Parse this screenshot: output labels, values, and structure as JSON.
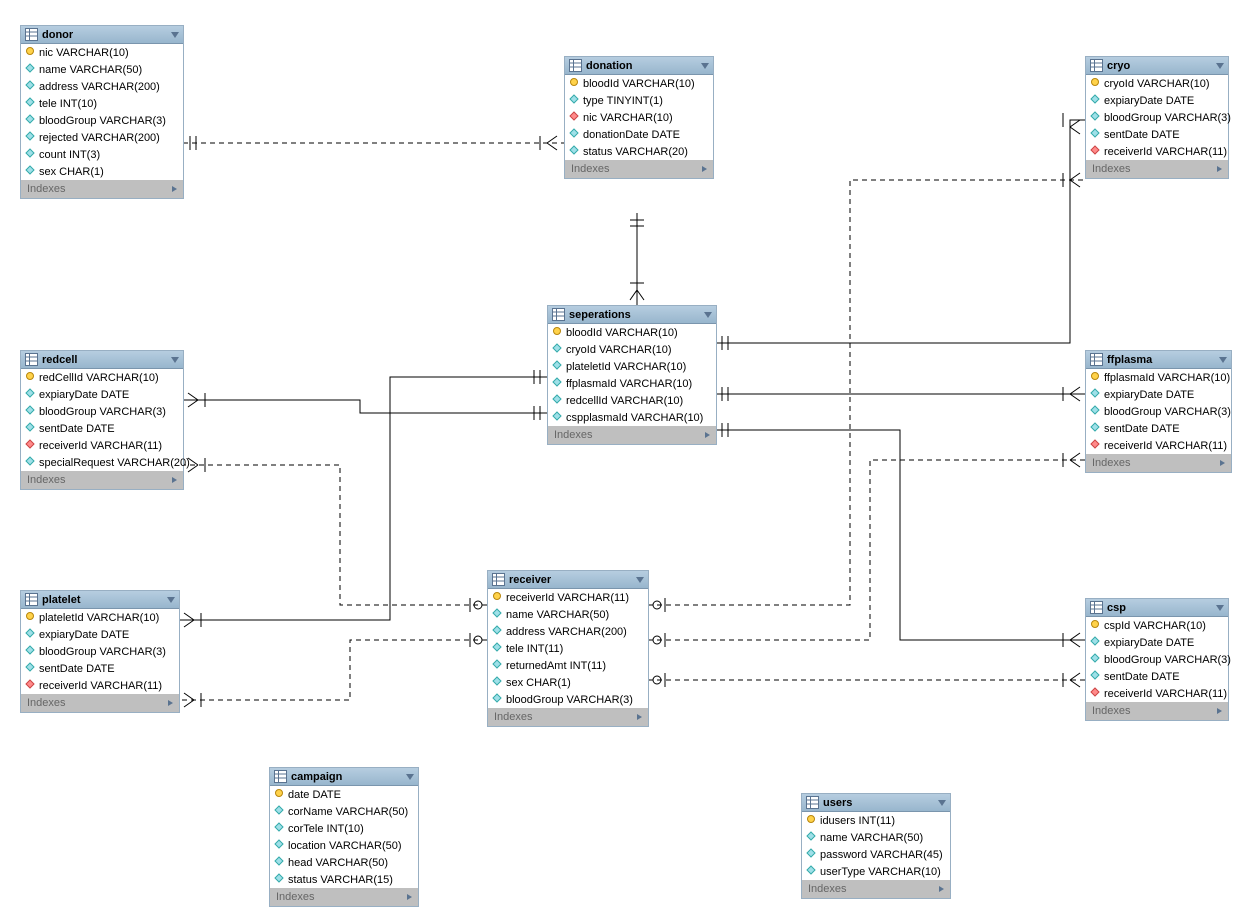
{
  "indexes_label": "Indexes",
  "tables": {
    "donor": {
      "title": "donor",
      "cols": [
        {
          "icon": "pk",
          "text": "nic VARCHAR(10)"
        },
        {
          "icon": "attr",
          "text": "name VARCHAR(50)"
        },
        {
          "icon": "attr",
          "text": "address VARCHAR(200)"
        },
        {
          "icon": "attr",
          "text": "tele INT(10)"
        },
        {
          "icon": "attr",
          "text": "bloodGroup VARCHAR(3)"
        },
        {
          "icon": "attr",
          "text": "rejected VARCHAR(200)"
        },
        {
          "icon": "attr",
          "text": "count INT(3)"
        },
        {
          "icon": "attr",
          "text": "sex CHAR(1)"
        }
      ]
    },
    "donation": {
      "title": "donation",
      "cols": [
        {
          "icon": "pk",
          "text": "bloodId VARCHAR(10)"
        },
        {
          "icon": "attr",
          "text": "type TINYINT(1)"
        },
        {
          "icon": "fk",
          "text": "nic VARCHAR(10)"
        },
        {
          "icon": "attr",
          "text": "donationDate DATE"
        },
        {
          "icon": "attr",
          "text": "status VARCHAR(20)"
        }
      ]
    },
    "cryo": {
      "title": "cryo",
      "cols": [
        {
          "icon": "pk",
          "text": "cryoId VARCHAR(10)"
        },
        {
          "icon": "attr",
          "text": "expiaryDate DATE"
        },
        {
          "icon": "attr",
          "text": "bloodGroup VARCHAR(3)"
        },
        {
          "icon": "attr",
          "text": "sentDate DATE"
        },
        {
          "icon": "fk",
          "text": "receiverId VARCHAR(11)"
        }
      ]
    },
    "redcell": {
      "title": "redcell",
      "cols": [
        {
          "icon": "pk",
          "text": "redCellId VARCHAR(10)"
        },
        {
          "icon": "attr",
          "text": "expiaryDate DATE"
        },
        {
          "icon": "attr",
          "text": "bloodGroup VARCHAR(3)"
        },
        {
          "icon": "attr",
          "text": "sentDate DATE"
        },
        {
          "icon": "fk",
          "text": "receiverId VARCHAR(11)"
        },
        {
          "icon": "attr",
          "text": "specialRequest VARCHAR(20)"
        }
      ]
    },
    "seperations": {
      "title": "seperations",
      "cols": [
        {
          "icon": "pk",
          "text": "bloodId VARCHAR(10)"
        },
        {
          "icon": "attr",
          "text": "cryoId VARCHAR(10)"
        },
        {
          "icon": "attr",
          "text": "plateletId VARCHAR(10)"
        },
        {
          "icon": "attr",
          "text": "ffplasmaId VARCHAR(10)"
        },
        {
          "icon": "attr",
          "text": "redcellId VARCHAR(10)"
        },
        {
          "icon": "attr",
          "text": "cspplasmaId VARCHAR(10)"
        }
      ]
    },
    "ffplasma": {
      "title": "ffplasma",
      "cols": [
        {
          "icon": "pk",
          "text": "ffplasmaId VARCHAR(10)"
        },
        {
          "icon": "attr",
          "text": "expiaryDate DATE"
        },
        {
          "icon": "attr",
          "text": "bloodGroup VARCHAR(3)"
        },
        {
          "icon": "attr",
          "text": "sentDate DATE"
        },
        {
          "icon": "fk",
          "text": "receiverId VARCHAR(11)"
        }
      ]
    },
    "platelet": {
      "title": "platelet",
      "cols": [
        {
          "icon": "pk",
          "text": "plateletId VARCHAR(10)"
        },
        {
          "icon": "attr",
          "text": "expiaryDate DATE"
        },
        {
          "icon": "attr",
          "text": "bloodGroup VARCHAR(3)"
        },
        {
          "icon": "attr",
          "text": "sentDate DATE"
        },
        {
          "icon": "fk",
          "text": "receiverId VARCHAR(11)"
        }
      ]
    },
    "receiver": {
      "title": "receiver",
      "cols": [
        {
          "icon": "pk",
          "text": "receiverId VARCHAR(11)"
        },
        {
          "icon": "attr",
          "text": "name VARCHAR(50)"
        },
        {
          "icon": "attr",
          "text": "address VARCHAR(200)"
        },
        {
          "icon": "attr",
          "text": "tele INT(11)"
        },
        {
          "icon": "attr",
          "text": "returnedAmt INT(11)"
        },
        {
          "icon": "attr",
          "text": "sex CHAR(1)"
        },
        {
          "icon": "attr",
          "text": "bloodGroup VARCHAR(3)"
        }
      ]
    },
    "csp": {
      "title": "csp",
      "cols": [
        {
          "icon": "pk",
          "text": "cspId VARCHAR(10)"
        },
        {
          "icon": "attr",
          "text": "expiaryDate DATE"
        },
        {
          "icon": "attr",
          "text": "bloodGroup VARCHAR(3)"
        },
        {
          "icon": "attr",
          "text": "sentDate DATE"
        },
        {
          "icon": "fk",
          "text": "receiverId VARCHAR(11)"
        }
      ]
    },
    "campaign": {
      "title": "campaign",
      "cols": [
        {
          "icon": "pk",
          "text": "date DATE"
        },
        {
          "icon": "attr",
          "text": "corName VARCHAR(50)"
        },
        {
          "icon": "attr",
          "text": "corTele INT(10)"
        },
        {
          "icon": "attr",
          "text": "location VARCHAR(50)"
        },
        {
          "icon": "attr",
          "text": "head VARCHAR(50)"
        },
        {
          "icon": "attr",
          "text": "status VARCHAR(15)"
        }
      ]
    },
    "users": {
      "title": "users",
      "cols": [
        {
          "icon": "pk",
          "text": "idusers INT(11)"
        },
        {
          "icon": "attr",
          "text": "name VARCHAR(50)"
        },
        {
          "icon": "attr",
          "text": "password VARCHAR(45)"
        },
        {
          "icon": "attr",
          "text": "userType VARCHAR(10)"
        }
      ]
    }
  }
}
